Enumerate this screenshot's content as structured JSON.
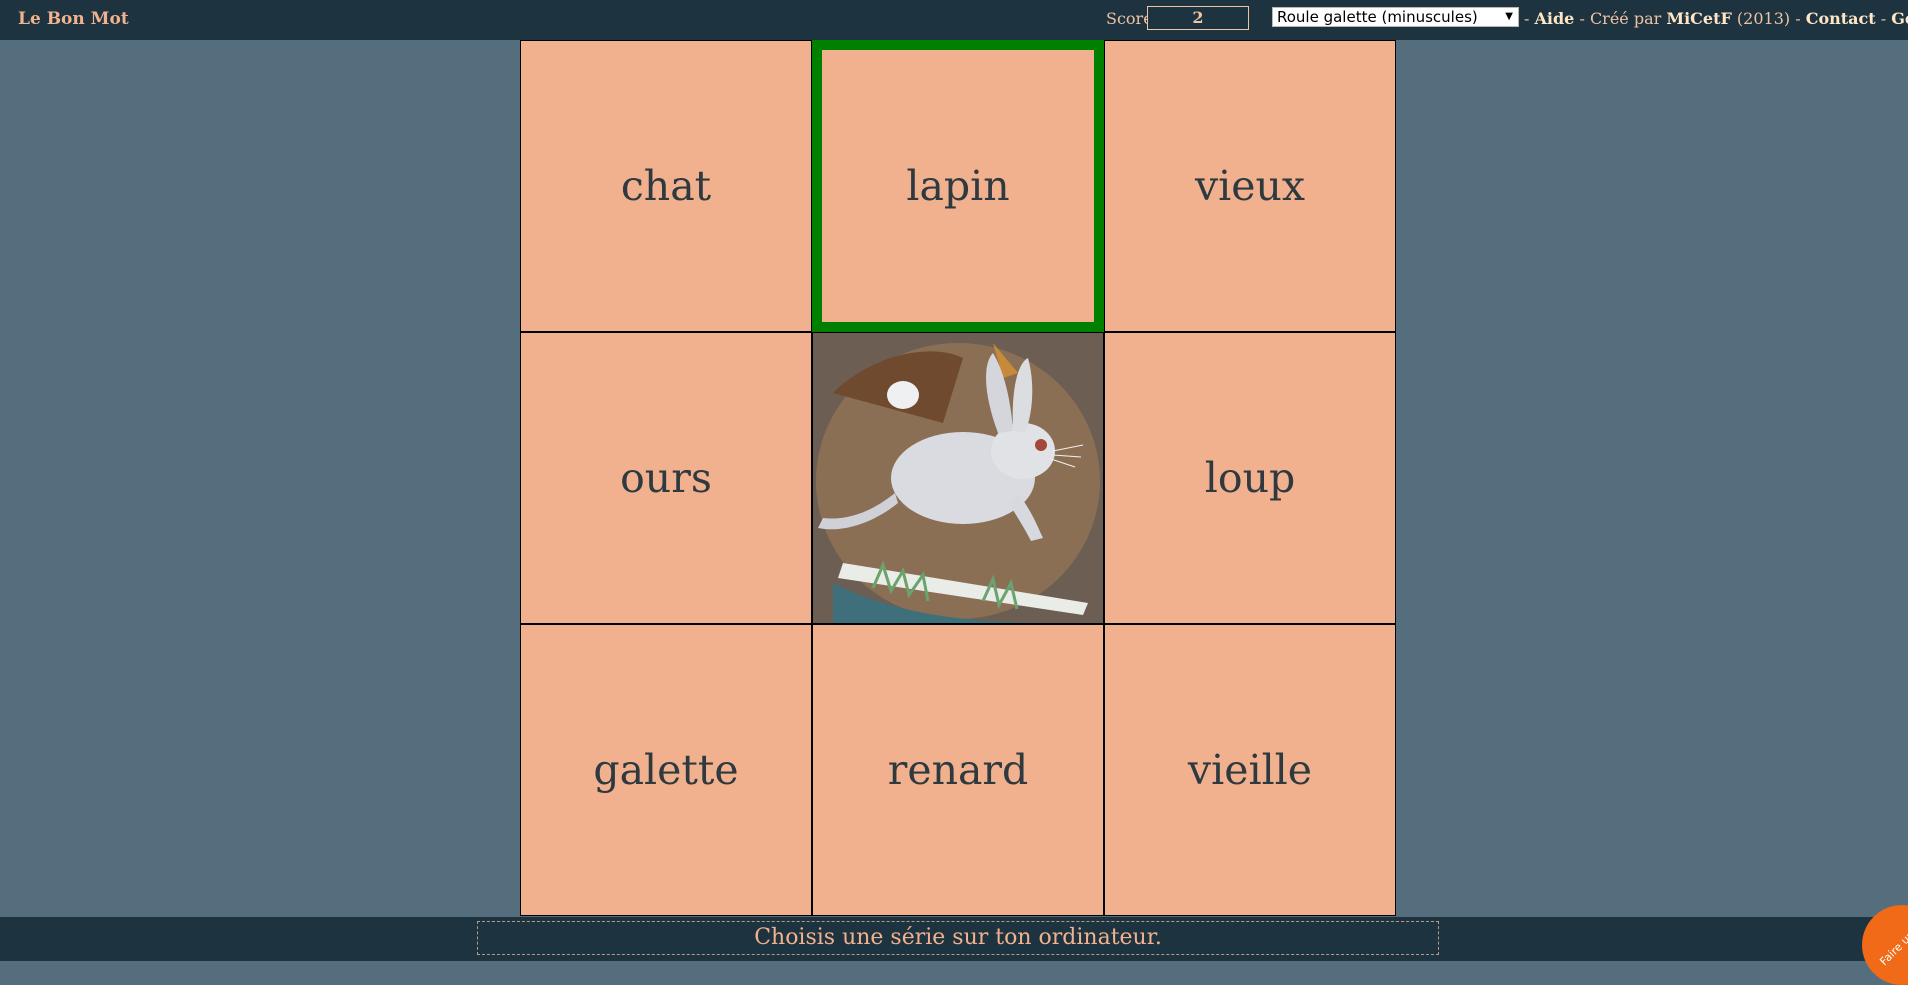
{
  "header": {
    "brand": "Le Bon Mot",
    "score_label": "Score",
    "score_value": "2",
    "series_selected": "Roule galette (minuscules)",
    "sep1": " - ",
    "help_link": "Aide",
    "sep2": " - Créé par ",
    "author": "MiCetF",
    "year": " (2013) - ",
    "contact_link": "Contact",
    "sep3": " - ",
    "generator_link": "Générateur"
  },
  "board": {
    "cells": [
      {
        "word": "chat"
      },
      {
        "word": "lapin",
        "state": "selected"
      },
      {
        "word": "vieux"
      },
      {
        "word": "ours"
      },
      {
        "image": "rabbit-picture"
      },
      {
        "word": "loup"
      },
      {
        "word": "galette"
      },
      {
        "word": "renard"
      },
      {
        "word": "vieille"
      }
    ]
  },
  "status": {
    "message": "Choisis une série sur ton ordinateur."
  },
  "donate": {
    "label": "Faire un don"
  },
  "colors": {
    "background": "#546e7e",
    "bars": "#1d3340",
    "tile": "#f1b18e",
    "selected_border": "#008000",
    "accent_text": "#f2b28e"
  }
}
